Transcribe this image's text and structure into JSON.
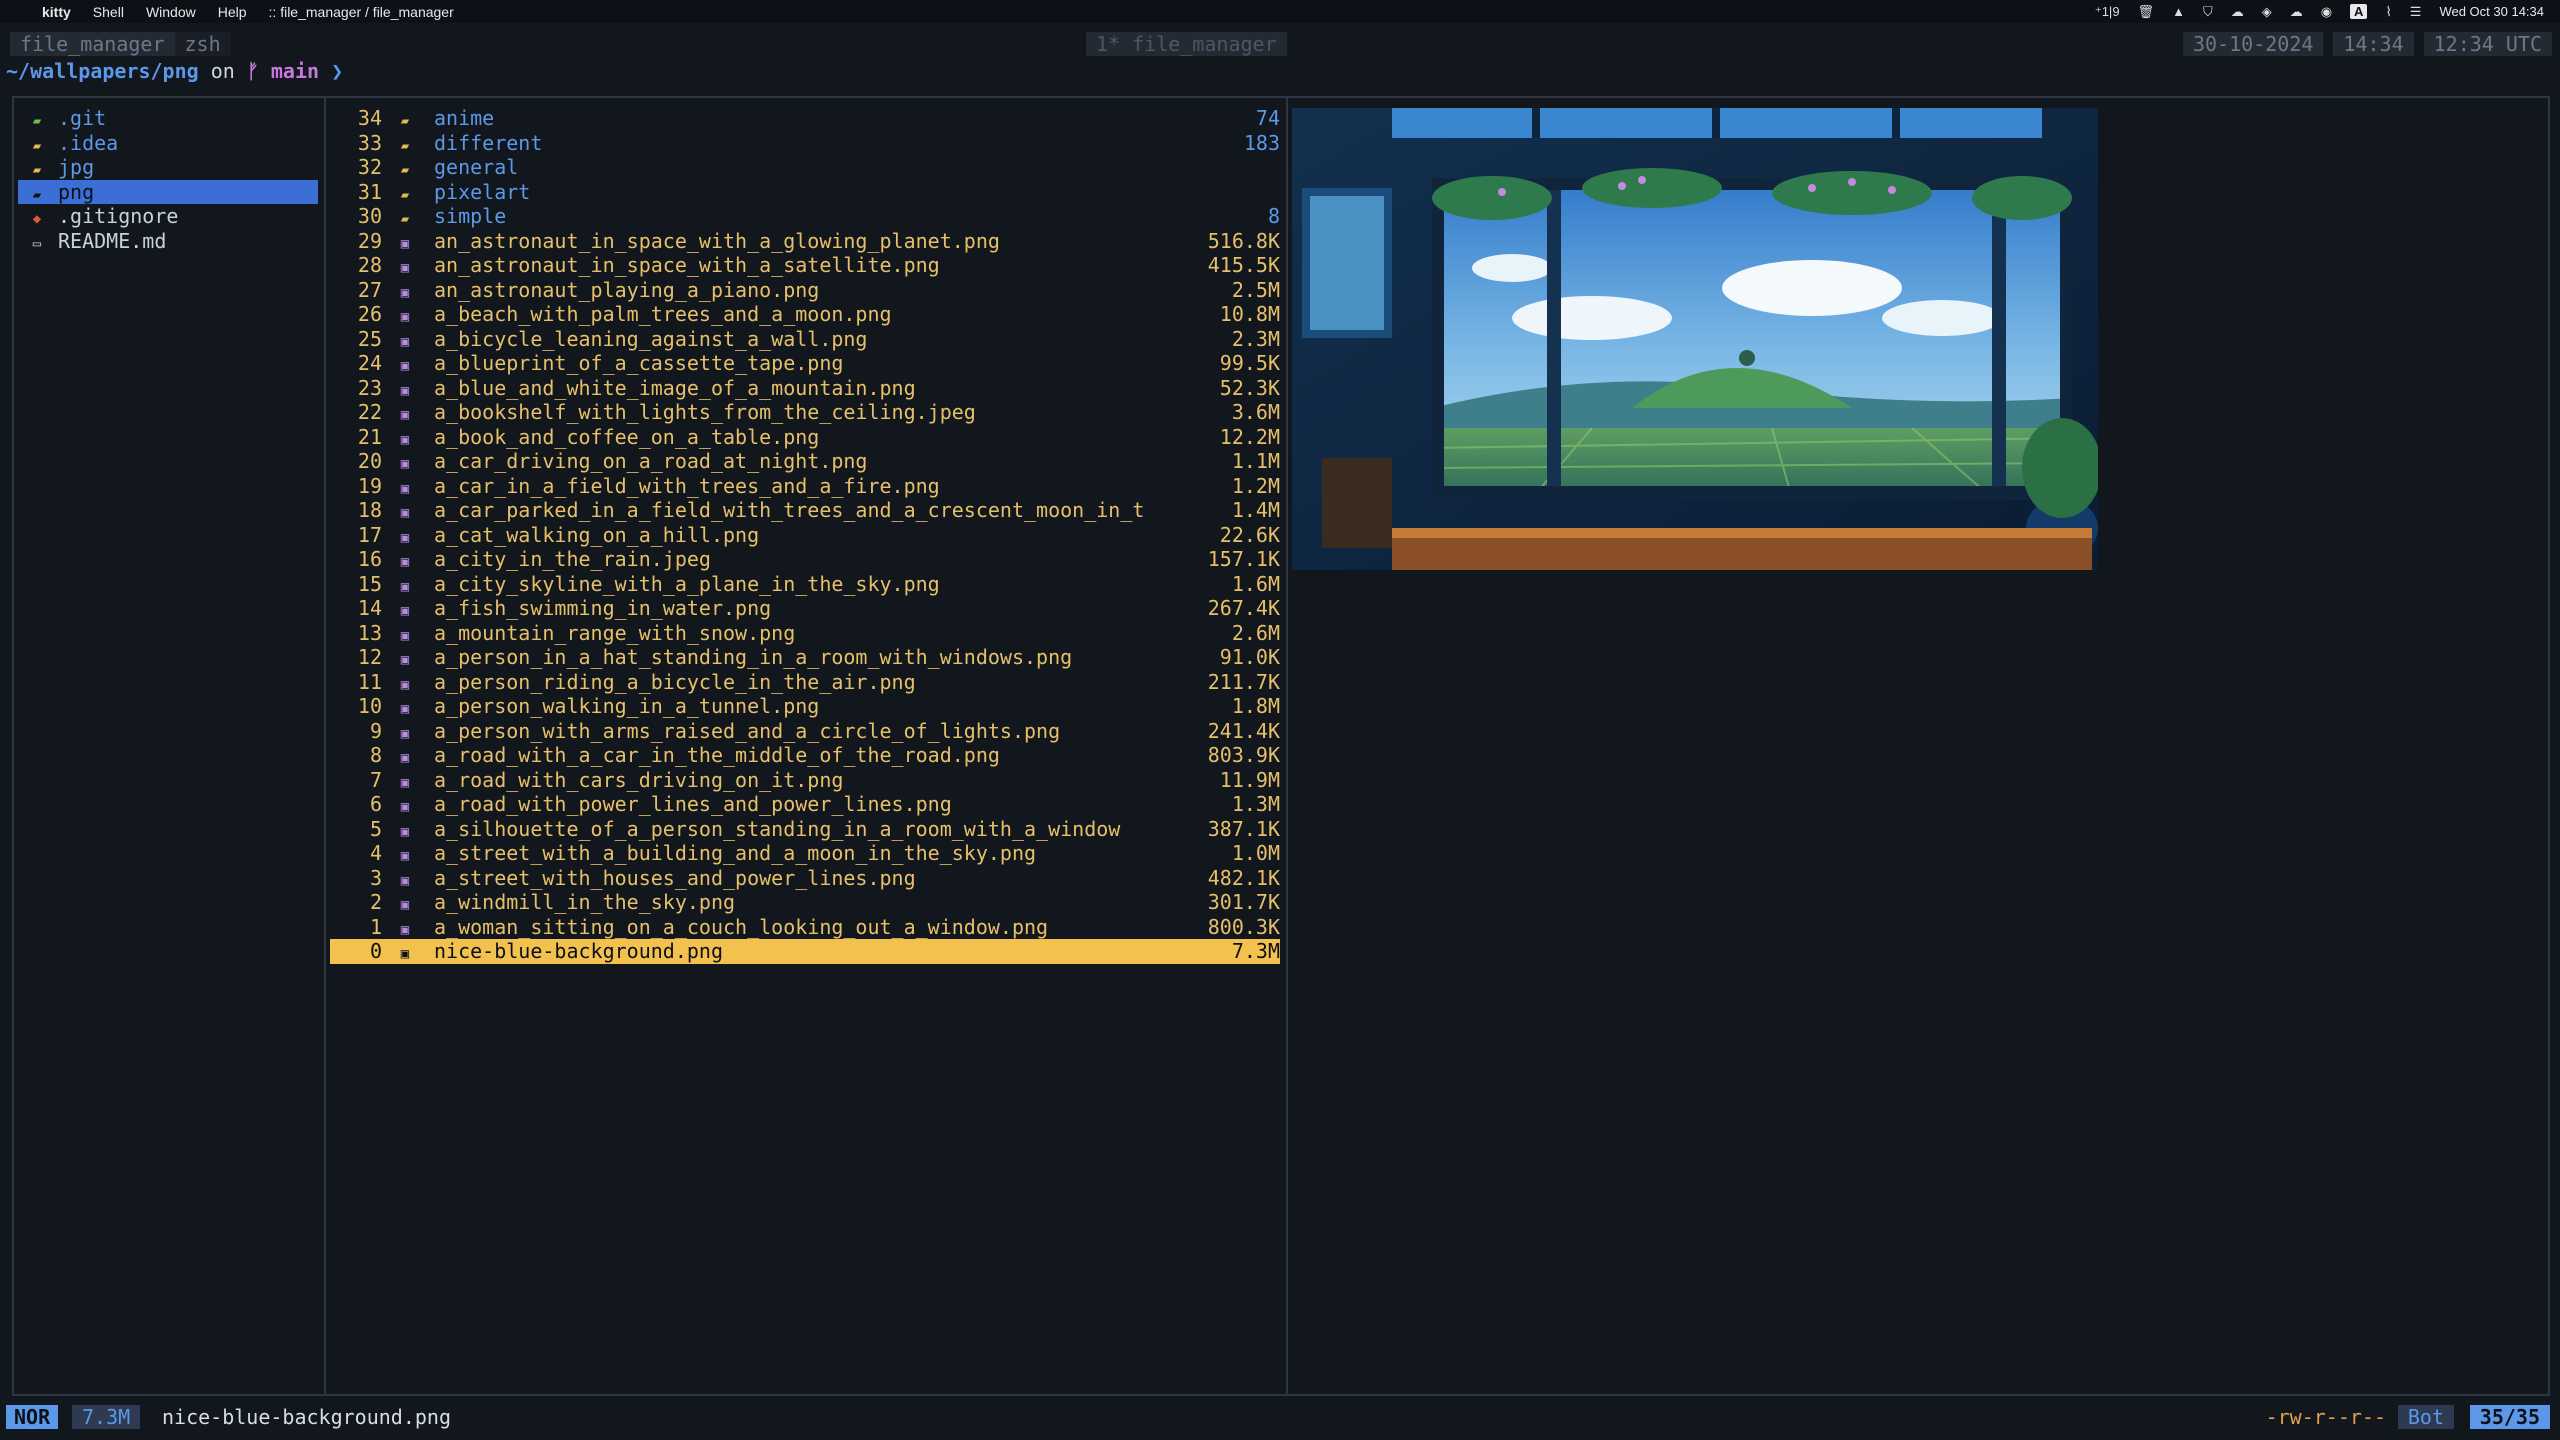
{
  "menubar": {
    "app": "kitty",
    "items": [
      "Shell",
      "Window",
      "Help"
    ],
    "title": ":: file_manager / file_manager",
    "status_icons": [
      "⁺1|9",
      "trash-icon",
      "triangle-icon",
      "shield-icon",
      "cloud-icon",
      "dropbox-icon",
      "cloud2-icon",
      "record-icon",
      "input-A-icon",
      "wifi-off-icon",
      "control-center-icon"
    ],
    "input_label": "A",
    "clock": "Wed Oct 30  14:34"
  },
  "tmux": {
    "tabs": [
      "file_manager",
      "zsh"
    ],
    "window": "1*  file_manager",
    "date": "30-10-2024",
    "time_local": "14:34",
    "time_utc": "12:34 UTC"
  },
  "prompt": {
    "path": "~/wallpapers/png",
    "on": "on",
    "branch_icon": "",
    "branch": "main",
    "arrow": "❯"
  },
  "left_pane": [
    {
      "label": ".git",
      "kind": "git"
    },
    {
      "label": ".idea",
      "kind": "dir"
    },
    {
      "label": "jpg",
      "kind": "dir"
    },
    {
      "label": "png",
      "kind": "dir",
      "selected": true
    },
    {
      "label": ".gitignore",
      "kind": "gitignore"
    },
    {
      "label": "README.md",
      "kind": "md"
    }
  ],
  "entries": [
    {
      "num": "34",
      "name": "anime",
      "size": "74",
      "dir": true
    },
    {
      "num": "33",
      "name": "different",
      "size": "183",
      "dir": true
    },
    {
      "num": "32",
      "name": "general",
      "size": "",
      "dir": true
    },
    {
      "num": "31",
      "name": "pixelart",
      "size": "",
      "dir": true
    },
    {
      "num": "30",
      "name": "simple",
      "size": "8",
      "dir": true
    },
    {
      "num": "29",
      "name": "an_astronaut_in_space_with_a_glowing_planet.png",
      "size": "516.8K"
    },
    {
      "num": "28",
      "name": "an_astronaut_in_space_with_a_satellite.png",
      "size": "415.5K"
    },
    {
      "num": "27",
      "name": "an_astronaut_playing_a_piano.png",
      "size": "2.5M"
    },
    {
      "num": "26",
      "name": "a_beach_with_palm_trees_and_a_moon.png",
      "size": "10.8M"
    },
    {
      "num": "25",
      "name": "a_bicycle_leaning_against_a_wall.png",
      "size": "2.3M"
    },
    {
      "num": "24",
      "name": "a_blueprint_of_a_cassette_tape.png",
      "size": "99.5K"
    },
    {
      "num": "23",
      "name": "a_blue_and_white_image_of_a_mountain.png",
      "size": "52.3K"
    },
    {
      "num": "22",
      "name": "a_bookshelf_with_lights_from_the_ceiling.jpeg",
      "size": "3.6M"
    },
    {
      "num": "21",
      "name": "a_book_and_coffee_on_a_table.png",
      "size": "12.2M"
    },
    {
      "num": "20",
      "name": "a_car_driving_on_a_road_at_night.png",
      "size": "1.1M"
    },
    {
      "num": "19",
      "name": "a_car_in_a_field_with_trees_and_a_fire.png",
      "size": "1.2M"
    },
    {
      "num": "18",
      "name": "a_car_parked_in_a_field_with_trees_and_a_crescent_moon_in_t",
      "size": "1.4M"
    },
    {
      "num": "17",
      "name": "a_cat_walking_on_a_hill.png",
      "size": "22.6K"
    },
    {
      "num": "16",
      "name": "a_city_in_the_rain.jpeg",
      "size": "157.1K"
    },
    {
      "num": "15",
      "name": "a_city_skyline_with_a_plane_in_the_sky.png",
      "size": "1.6M"
    },
    {
      "num": "14",
      "name": "a_fish_swimming_in_water.png",
      "size": "267.4K"
    },
    {
      "num": "13",
      "name": "a_mountain_range_with_snow.png",
      "size": "2.6M"
    },
    {
      "num": "12",
      "name": "a_person_in_a_hat_standing_in_a_room_with_windows.png",
      "size": "91.0K"
    },
    {
      "num": "11",
      "name": "a_person_riding_a_bicycle_in_the_air.png",
      "size": "211.7K"
    },
    {
      "num": "10",
      "name": "a_person_walking_in_a_tunnel.png",
      "size": "1.8M"
    },
    {
      "num": "9",
      "name": "a_person_with_arms_raised_and_a_circle_of_lights.png",
      "size": "241.4K"
    },
    {
      "num": "8",
      "name": "a_road_with_a_car_in_the_middle_of_the_road.png",
      "size": "803.9K"
    },
    {
      "num": "7",
      "name": "a_road_with_cars_driving_on_it.png",
      "size": "11.9M"
    },
    {
      "num": "6",
      "name": "a_road_with_power_lines_and_power_lines.png",
      "size": "1.3M"
    },
    {
      "num": "5",
      "name": "a_silhouette_of_a_person_standing_in_a_room_with_a_window",
      "size": "387.1K"
    },
    {
      "num": "4",
      "name": "a_street_with_a_building_and_a_moon_in_the_sky.png",
      "size": "1.0M"
    },
    {
      "num": "3",
      "name": "a_street_with_houses_and_power_lines.png",
      "size": "482.1K"
    },
    {
      "num": "2",
      "name": "a_windmill_in_the_sky.png",
      "size": "301.7K"
    },
    {
      "num": "1",
      "name": "a_woman_sitting_on_a_couch_looking_out_a_window.png",
      "size": "800.3K"
    },
    {
      "num": "0",
      "name": "nice-blue-background.png",
      "size": "7.3M",
      "selected": true
    }
  ],
  "status": {
    "mode": "NOR",
    "size": "7.3M",
    "filename": "nice-blue-background.png",
    "permissions": "-rw-r--r--",
    "position": "Bot",
    "count": "35/35"
  },
  "colors": {
    "accent": "#5c98e8",
    "selection": "#f2c14e",
    "file_text": "#e6c069",
    "background": "#12161d"
  }
}
